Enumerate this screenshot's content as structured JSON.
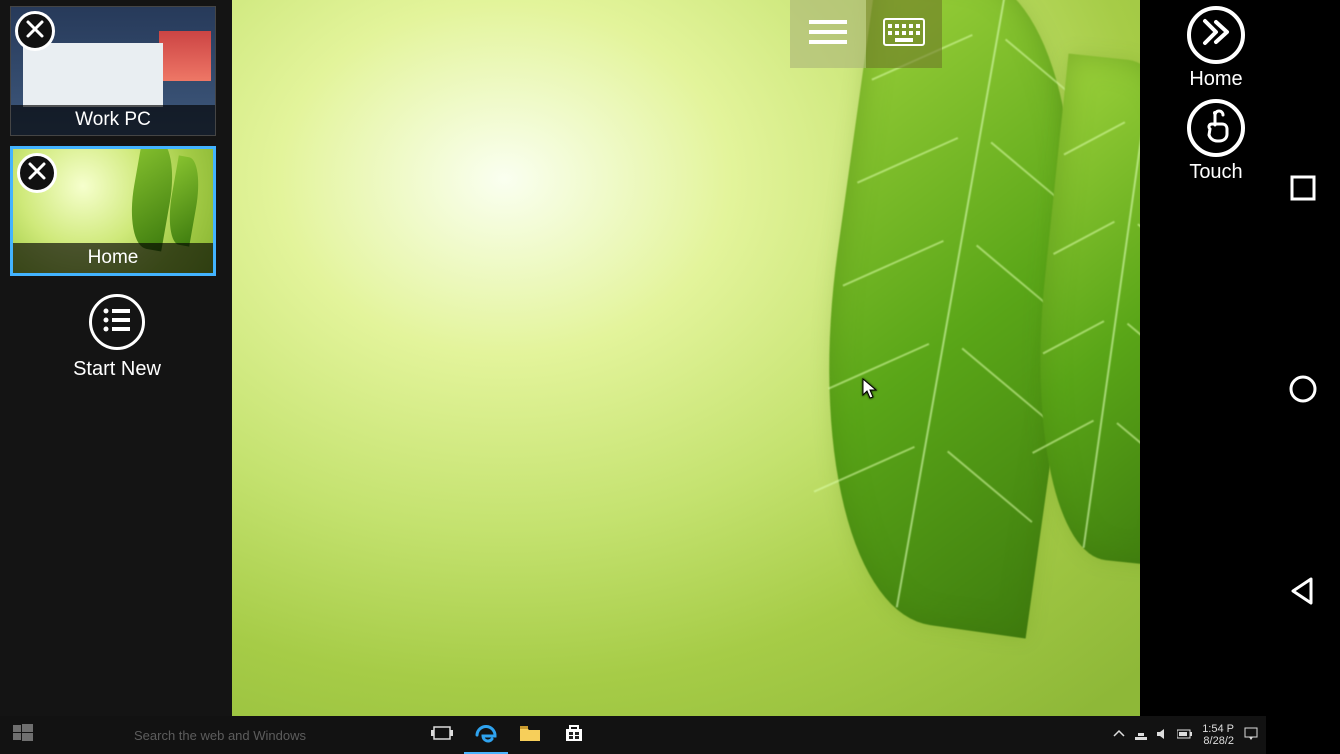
{
  "sessions": [
    {
      "label": "Work PC",
      "active": false
    },
    {
      "label": "Home",
      "active": true
    }
  ],
  "start_new_label": "Start New",
  "right_actions": {
    "home_label": "Home",
    "touch_label": "Touch"
  },
  "top_toolbar": {
    "hamburger_icon": "hamburger-icon",
    "keyboard_icon": "keyboard-icon"
  },
  "taskbar": {
    "search_placeholder": "Search the web and Windows",
    "clock_time": "1:54 P",
    "clock_date": "8/28/2"
  },
  "android_nav": {
    "recents": "square-icon",
    "home": "circle-icon",
    "back": "triangle-back-icon"
  }
}
